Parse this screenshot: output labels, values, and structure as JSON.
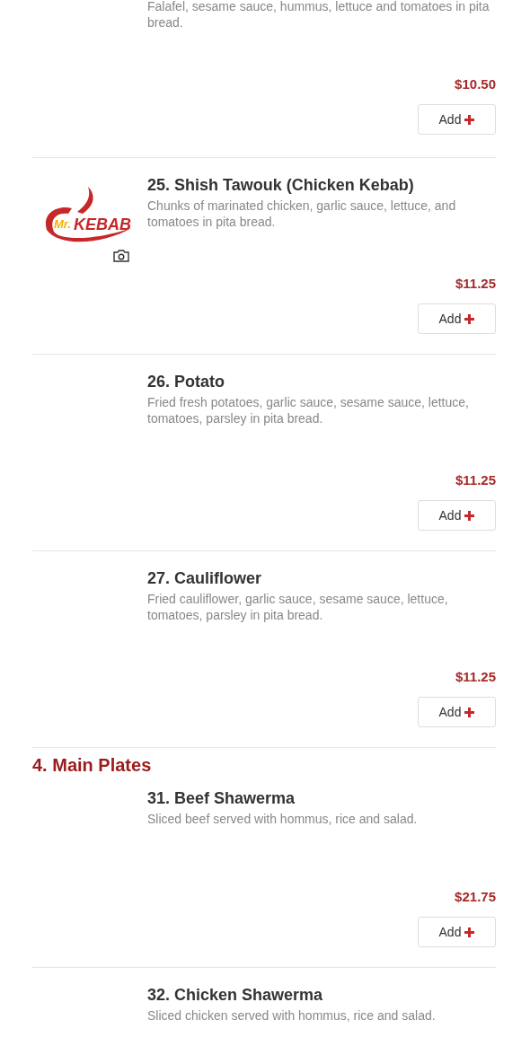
{
  "sections": [
    {
      "items": [
        {
          "description": "Falafel, sesame sauce, hummus, lettuce and tomatoes in pita bread.",
          "price": "$10.50",
          "button": "Add"
        }
      ]
    },
    {
      "items": [
        {
          "title": "25. Shish Tawouk (Chicken Kebab)",
          "description": "Chunks of marinated chicken, garlic sauce, lettuce, and tomatoes in pita bread.",
          "price": "$11.25",
          "button": "Add",
          "logo": {
            "prefix": "Mr.",
            "name": "KEBAB"
          }
        },
        {
          "title": "26. Potato",
          "description": "Fried fresh potatoes, garlic sauce, sesame sauce, lettuce, tomatoes, parsley in pita bread.",
          "price": "$11.25",
          "button": "Add"
        },
        {
          "title": "27. Cauliflower",
          "description": "Fried cauliflower, garlic sauce, sesame sauce, lettuce, tomatoes, parsley in pita bread.",
          "price": "$11.25",
          "button": "Add"
        }
      ]
    },
    {
      "heading": "4. Main Plates",
      "items": [
        {
          "title": "31. Beef Shawerma",
          "description": "Sliced beef served with hommus, rice and salad.",
          "price": "$21.75",
          "button": "Add"
        },
        {
          "title": "32. Chicken Shawerma",
          "description": "Sliced chicken served with hommus, rice and salad."
        }
      ]
    }
  ]
}
